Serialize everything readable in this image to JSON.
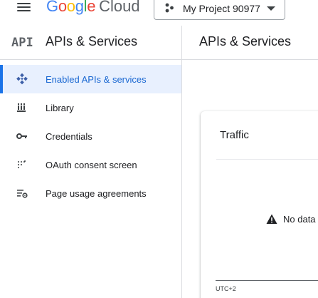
{
  "header": {
    "logo_google": [
      "G",
      "o",
      "o",
      "g",
      "l",
      "e"
    ],
    "logo_colors": [
      "#4285F4",
      "#EA4335",
      "#FBBC05",
      "#4285F4",
      "#34A853",
      "#EA4335"
    ],
    "logo_cloud": "Cloud",
    "project_name": "My Project 90977",
    "icons": {
      "menu": "hamburger-menu-icon",
      "project": "project-dots-icon",
      "caret": "caret-down-icon"
    }
  },
  "sidebar": {
    "badge": "API",
    "title": "APIs & Services",
    "items": [
      {
        "label": "Enabled APIs & services",
        "icon": "diamond-nodes-icon",
        "active": true
      },
      {
        "label": "Library",
        "icon": "library-icon",
        "active": false
      },
      {
        "label": "Credentials",
        "icon": "key-icon",
        "active": false
      },
      {
        "label": "OAuth consent screen",
        "icon": "dotted-grid-icon",
        "active": false
      },
      {
        "label": "Page usage agreements",
        "icon": "settings-list-icon",
        "active": false
      }
    ]
  },
  "main": {
    "title": "APIs & Services",
    "card": {
      "title": "Traffic",
      "empty_message": "No data",
      "timezone": "UTC+2"
    }
  },
  "colors": {
    "accent": "#1a73e8",
    "active_bg": "#e8f0fe",
    "active_text": "#1967d2"
  }
}
